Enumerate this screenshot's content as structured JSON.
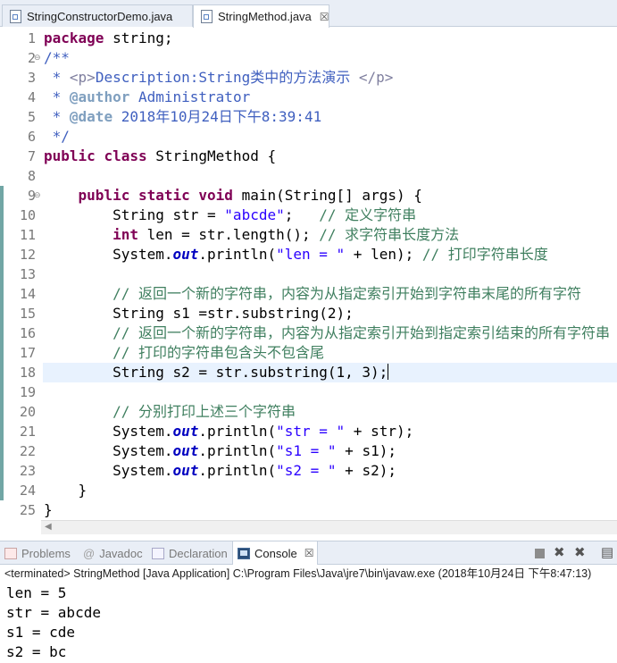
{
  "editor_tabs": [
    {
      "label": "StringConstructorDemo.java",
      "active": false
    },
    {
      "label": "StringMethod.java",
      "active": true,
      "close": "☒"
    }
  ],
  "editor": {
    "current_line": 18,
    "lines": [
      {
        "n": "1",
        "parts": [
          {
            "t": "package",
            "c": "kw"
          },
          {
            "t": " string;"
          }
        ]
      },
      {
        "n": "2",
        "fold": "⊖",
        "parts": [
          {
            "t": "/**",
            "c": "doc"
          }
        ]
      },
      {
        "n": "3",
        "parts": [
          {
            "t": " * ",
            "c": "doc"
          },
          {
            "t": "<p>",
            "c": "tag"
          },
          {
            "t": "Description:String类中的方法演示 ",
            "c": "doc"
          },
          {
            "t": "</p>",
            "c": "tag"
          }
        ]
      },
      {
        "n": "4",
        "parts": [
          {
            "t": " * ",
            "c": "doc"
          },
          {
            "t": "@author",
            "c": "at"
          },
          {
            "t": " Administrator",
            "c": "doc"
          }
        ]
      },
      {
        "n": "5",
        "parts": [
          {
            "t": " * ",
            "c": "doc"
          },
          {
            "t": "@date",
            "c": "at"
          },
          {
            "t": " 2018年10月24日下午8:39:41",
            "c": "doc"
          }
        ]
      },
      {
        "n": "6",
        "parts": [
          {
            "t": " */",
            "c": "doc"
          }
        ]
      },
      {
        "n": "7",
        "parts": [
          {
            "t": "public",
            "c": "kw"
          },
          {
            "t": " "
          },
          {
            "t": "class",
            "c": "kw"
          },
          {
            "t": " StringMethod {"
          }
        ]
      },
      {
        "n": "8",
        "parts": [
          {
            "t": ""
          }
        ]
      },
      {
        "n": "9",
        "fold": "⊖",
        "parts": [
          {
            "t": "    "
          },
          {
            "t": "public",
            "c": "kw"
          },
          {
            "t": " "
          },
          {
            "t": "static",
            "c": "kw"
          },
          {
            "t": " "
          },
          {
            "t": "void",
            "c": "kw"
          },
          {
            "t": " main(String[] args) {"
          }
        ]
      },
      {
        "n": "10",
        "parts": [
          {
            "t": "        String str = "
          },
          {
            "t": "\"abcde\"",
            "c": "str"
          },
          {
            "t": ";   "
          },
          {
            "t": "// 定义字符串",
            "c": "cm"
          }
        ]
      },
      {
        "n": "11",
        "parts": [
          {
            "t": "        "
          },
          {
            "t": "int",
            "c": "kw"
          },
          {
            "t": " len = str.length(); "
          },
          {
            "t": "// 求字符串长度方法",
            "c": "cm"
          }
        ]
      },
      {
        "n": "12",
        "parts": [
          {
            "t": "        System."
          },
          {
            "t": "out",
            "c": "fld"
          },
          {
            "t": ".println("
          },
          {
            "t": "\"len = \"",
            "c": "str"
          },
          {
            "t": " + len); "
          },
          {
            "t": "// 打印字符串长度",
            "c": "cm"
          }
        ]
      },
      {
        "n": "13",
        "parts": [
          {
            "t": ""
          }
        ]
      },
      {
        "n": "14",
        "parts": [
          {
            "t": "        "
          },
          {
            "t": "// 返回一个新的字符串，内容为从指定索引开始到字符串末尾的所有字符",
            "c": "cm"
          }
        ]
      },
      {
        "n": "15",
        "parts": [
          {
            "t": "        String s1 =str.substring(2);"
          }
        ]
      },
      {
        "n": "16",
        "parts": [
          {
            "t": "        "
          },
          {
            "t": "// 返回一个新的字符串，内容为从指定索引开始到指定索引结束的所有字符串",
            "c": "cm"
          }
        ]
      },
      {
        "n": "17",
        "parts": [
          {
            "t": "        "
          },
          {
            "t": "// 打印的字符串包含头不包含尾",
            "c": "cm"
          }
        ]
      },
      {
        "n": "18",
        "parts": [
          {
            "t": "        String s2 = str.substring(1, 3);"
          }
        ],
        "caret": true
      },
      {
        "n": "19",
        "parts": [
          {
            "t": ""
          }
        ]
      },
      {
        "n": "20",
        "parts": [
          {
            "t": "        "
          },
          {
            "t": "// 分别打印上述三个字符串",
            "c": "cm"
          }
        ]
      },
      {
        "n": "21",
        "parts": [
          {
            "t": "        System."
          },
          {
            "t": "out",
            "c": "fld"
          },
          {
            "t": ".println("
          },
          {
            "t": "\"str = \"",
            "c": "str"
          },
          {
            "t": " + str);"
          }
        ]
      },
      {
        "n": "22",
        "parts": [
          {
            "t": "        System."
          },
          {
            "t": "out",
            "c": "fld"
          },
          {
            "t": ".println("
          },
          {
            "t": "\"s1 = \"",
            "c": "str"
          },
          {
            "t": " + s1);"
          }
        ]
      },
      {
        "n": "23",
        "parts": [
          {
            "t": "        System."
          },
          {
            "t": "out",
            "c": "fld"
          },
          {
            "t": ".println("
          },
          {
            "t": "\"s2 = \"",
            "c": "str"
          },
          {
            "t": " + s2);"
          }
        ]
      },
      {
        "n": "24",
        "parts": [
          {
            "t": "    }"
          }
        ]
      },
      {
        "n": "25",
        "parts": [
          {
            "t": "}"
          }
        ]
      }
    ]
  },
  "views": {
    "tabs": [
      {
        "label": "Problems",
        "icon": "problems-icon",
        "active": false
      },
      {
        "label": "Javadoc",
        "icon": "javadoc-icon",
        "active": false,
        "glyph": "@"
      },
      {
        "label": "Declaration",
        "icon": "declaration-icon",
        "active": false
      },
      {
        "label": "Console",
        "icon": "console-icon",
        "active": true,
        "close": "☒"
      }
    ],
    "toolbar_glyphs": {
      "remove": "✖",
      "remove_all": "✖",
      "pin": "▤"
    }
  },
  "console": {
    "header": "<terminated> StringMethod [Java Application] C:\\Program Files\\Java\\jre7\\bin\\javaw.exe (2018年10月24日 下午8:47:13)",
    "output": [
      "len = 5",
      "str = abcde",
      "s1 = cde",
      "s2 = bc"
    ]
  },
  "colors": {
    "keyword": "#7f0055",
    "string": "#2a00ff",
    "comment": "#3f7f5f",
    "javadoc": "#3f5fbf",
    "current_line": "#e8f2fe",
    "change_ruler": "#71a6a5"
  }
}
